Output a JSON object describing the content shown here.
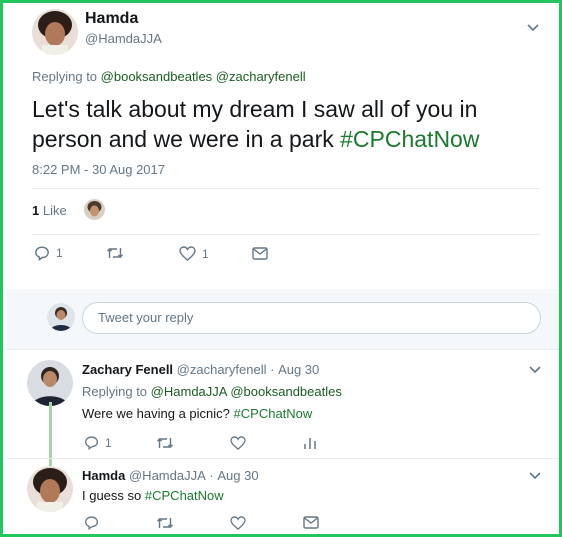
{
  "main_tweet": {
    "name": "Hamda",
    "handle": "@HamdaJJA",
    "replying_prefix": "Replying to",
    "replying_to": [
      "@booksandbeatles",
      "@zacharyfenell"
    ],
    "text": "Let's talk about my dream I saw all of you in person and we were in a park",
    "hashtag": "#CPChatNow",
    "timestamp": "8:22 PM - 30 Aug 2017",
    "likes_count": "1",
    "likes_label": "Like",
    "actions": {
      "reply_count": "1",
      "like_count": "1"
    }
  },
  "reply_box": {
    "placeholder": "Tweet your reply"
  },
  "thread": [
    {
      "name": "Zachary Fenell",
      "handle": "@zacharyfenell",
      "date": "Aug 30",
      "separator": "·",
      "replying_prefix": "Replying to",
      "replying_to": [
        "@HamdaJJA",
        "@booksandbeatles"
      ],
      "text": "Were we having a picnic?",
      "hashtag": "#CPChatNow",
      "reply_count": "1"
    },
    {
      "name": "Hamda",
      "handle": "@HamdaJJA",
      "date": "Aug 30",
      "separator": "·",
      "text": "I guess so",
      "hashtag": "#CPChatNow"
    }
  ],
  "colors": {
    "border": "#22c55e",
    "link": "#1b5e20",
    "hashtag": "#1b7a2e",
    "muted": "#657786",
    "thread_line": "#a7d3a9"
  },
  "icons": [
    "chevron-down-icon",
    "reply-icon",
    "retweet-icon",
    "heart-icon",
    "message-icon",
    "analytics-icon"
  ]
}
